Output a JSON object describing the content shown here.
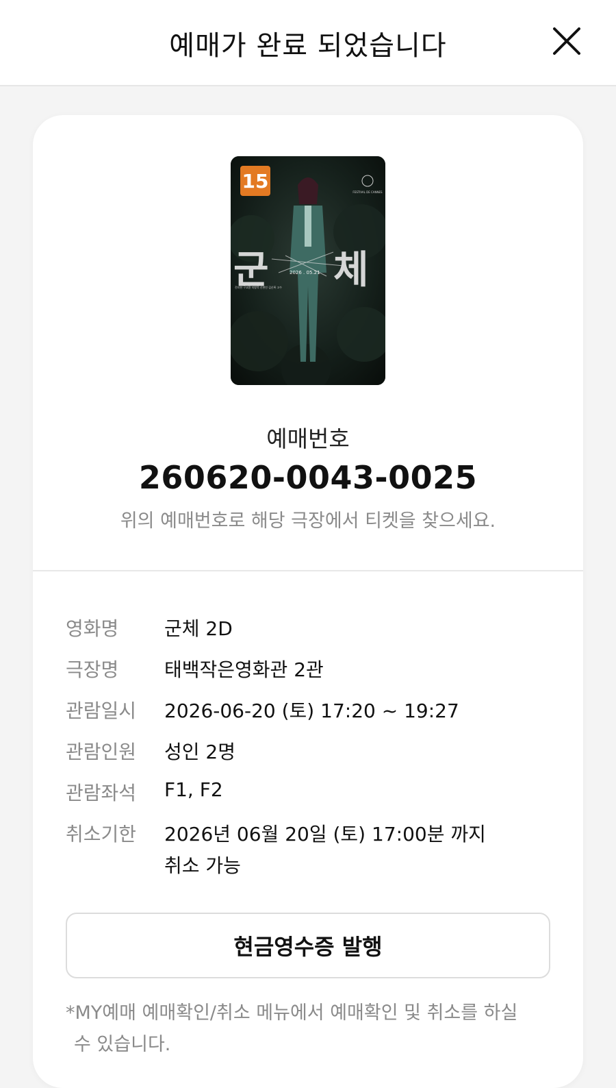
{
  "header": {
    "title": "예매가 완료 되었습니다",
    "close_icon": "close-icon"
  },
  "poster": {
    "rating_badge": "15",
    "title_text": "군 체",
    "release_text": "2026.05.21",
    "accent_color": "#e37a23"
  },
  "booking": {
    "label": "예매번호",
    "number": "260620-0043-0025",
    "hint": "위의 예매번호로 해당 극장에서 티켓을 찾으세요."
  },
  "details": [
    {
      "label": "영화명",
      "value": "군체 2D"
    },
    {
      "label": "극장명",
      "value": "태백작은영화관 2관"
    },
    {
      "label": "관람일시",
      "value": "2026-06-20 (토) 17:20 ~ 19:27"
    },
    {
      "label": "관람인원",
      "value": "성인 2명"
    },
    {
      "label": "관람좌석",
      "value": "F1, F2"
    },
    {
      "label": "취소기한",
      "value": "2026년 06월 20일 (토) 17:00분 까지",
      "value_line2": "취소 가능"
    }
  ],
  "receipt_button": {
    "label": "현금영수증 발행"
  },
  "footnote": {
    "line1": "*MY예매 예매확인/취소 메뉴에서 예매확인 및 취소를 하실",
    "line2": "수 있습니다."
  }
}
